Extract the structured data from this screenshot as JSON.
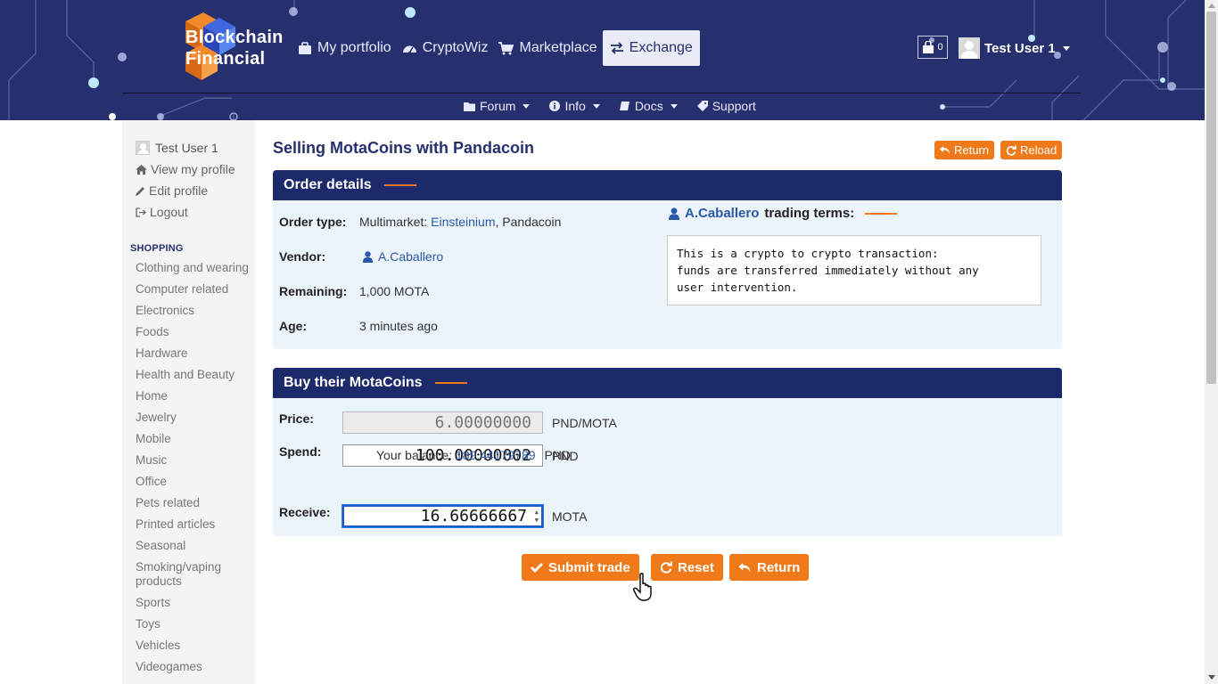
{
  "brand": {
    "line1": "Blockchain",
    "line2": "Financial"
  },
  "nav_main": [
    {
      "label": "My portfolio",
      "icon": "briefcase-icon"
    },
    {
      "label": "CryptoWiz",
      "icon": "dashboard-icon"
    },
    {
      "label": "Marketplace",
      "icon": "cart-icon"
    },
    {
      "label": "Exchange",
      "icon": "exchange-icon",
      "active": true
    }
  ],
  "nav_sub": [
    {
      "label": "Forum",
      "icon": "folder-icon"
    },
    {
      "label": "Info",
      "icon": "info-icon"
    },
    {
      "label": "Docs",
      "icon": "book-icon"
    },
    {
      "label": "Support",
      "icon": "tag-icon"
    }
  ],
  "cart": {
    "count": "0"
  },
  "user": {
    "name": "Test User 1"
  },
  "sidebar": {
    "user_name": "Test User 1",
    "links": [
      {
        "label": "View my profile",
        "icon": "home-icon"
      },
      {
        "label": "Edit profile",
        "icon": "pencil-icon"
      },
      {
        "label": "Logout",
        "icon": "logout-icon"
      }
    ],
    "section_title": "SHOPPING",
    "categories": [
      "Clothing and wearing",
      "Computer related",
      "Electronics",
      "Foods",
      "Hardware",
      "Health and Beauty",
      "Home",
      "Jewelry",
      "Mobile",
      "Music",
      "Office",
      "Pets related",
      "Printed articles",
      "Seasonal",
      "Smoking/vaping products",
      "Sports",
      "Toys",
      "Vehicles",
      "Videogames"
    ]
  },
  "page": {
    "title": "Selling MotaCoins with Pandacoin",
    "return_label": "Return",
    "reload_label": "Reload"
  },
  "order": {
    "heading": "Order details",
    "type_label": "Order type:",
    "type_prefix": "Multimarket:",
    "type_link": "Einsteinium",
    "type_suffix": ", Pandacoin",
    "vendor_label": "Vendor:",
    "vendor": "A.Caballero",
    "remaining_label": "Remaining:",
    "remaining": "1,000 MOTA",
    "age_label": "Age:",
    "age": "3 minutes ago",
    "terms_user": "A.Caballero",
    "terms_suffix": "trading terms:",
    "terms_text": "This is a crypto to crypto transaction:\nfunds are transferred immediately without any\nuser intervention."
  },
  "buy": {
    "heading": "Buy their MotaCoins",
    "price_label": "Price:",
    "price": "6.00000000",
    "price_unit": "PND/MOTA",
    "spend_label": "Spend:",
    "spend": "100.00000002",
    "spend_unit": "PND",
    "balance_label": "Your balance:",
    "balance": "189.44179789",
    "balance_unit": "PND",
    "receive_label": "Receive:",
    "receive": "16.66666667",
    "receive_unit": "MOTA"
  },
  "actions": {
    "submit": "Submit trade",
    "reset": "Reset",
    "return": "Return"
  },
  "colors": {
    "header_bg": "#27306e",
    "panel_head": "#1c2a6b",
    "accent": "#f07a1a",
    "link": "#2a58a8"
  }
}
